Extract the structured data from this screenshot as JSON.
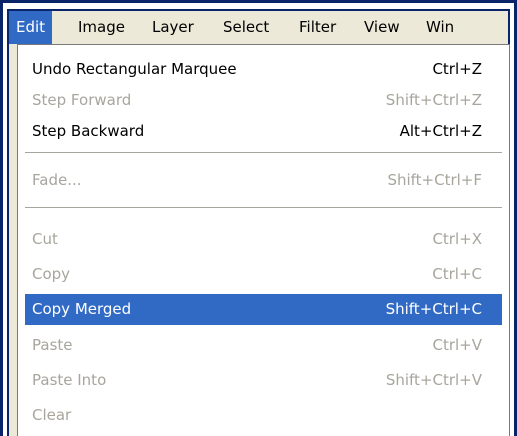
{
  "menubar": {
    "items": [
      {
        "label": "Edit"
      },
      {
        "label": "Image"
      },
      {
        "label": "Layer"
      },
      {
        "label": "Select"
      },
      {
        "label": "Filter"
      },
      {
        "label": "View"
      },
      {
        "label": "Win"
      }
    ],
    "active_item": "Edit",
    "highlight_color": "#316ac5",
    "bar_color": "#ece9d8"
  },
  "edit_menu": {
    "items": [
      {
        "label": "Undo Rectangular Marquee",
        "shortcut": "Ctrl+Z",
        "enabled": true
      },
      {
        "label": "Step Forward",
        "shortcut": "Shift+Ctrl+Z",
        "enabled": false
      },
      {
        "label": "Step Backward",
        "shortcut": "Alt+Ctrl+Z",
        "enabled": true
      },
      {
        "label": "Fade...",
        "shortcut": "Shift+Ctrl+F",
        "enabled": false
      },
      {
        "label": "Cut",
        "shortcut": "Ctrl+X",
        "enabled": false
      },
      {
        "label": "Copy",
        "shortcut": "Ctrl+C",
        "enabled": false
      },
      {
        "label": "Copy Merged",
        "shortcut": "Shift+Ctrl+C",
        "enabled": true,
        "highlighted": true
      },
      {
        "label": "Paste",
        "shortcut": "Ctrl+V",
        "enabled": false
      },
      {
        "label": "Paste Into",
        "shortcut": "Shift+Ctrl+V",
        "enabled": false
      },
      {
        "label": "Clear",
        "enabled": false
      }
    ],
    "disabled_text_color": "#a7a59c"
  }
}
